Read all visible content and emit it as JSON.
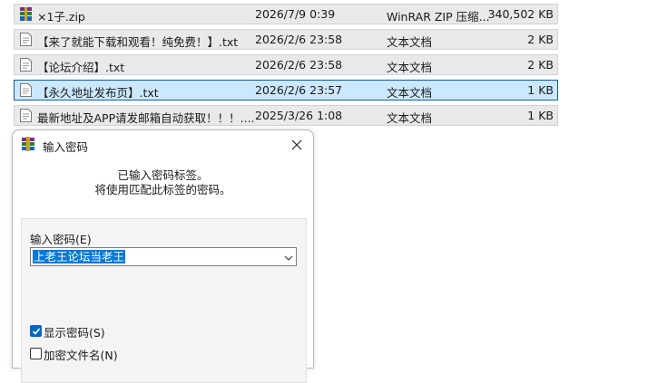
{
  "files": [
    {
      "name": "×1子.zip",
      "date": "2026/7/9 0:39",
      "type": "WinRAR ZIP 压缩...",
      "size": "340,502 KB",
      "icon": "winrar-archive-icon",
      "selected": false
    },
    {
      "name": "【来了就能下载和观看！纯免费！】.txt",
      "date": "2026/2/6 23:58",
      "type": "文本文档",
      "size": "2 KB",
      "icon": "text-file-icon",
      "selected": false
    },
    {
      "name": "【论坛介绍】.txt",
      "date": "2026/2/6 23:58",
      "type": "文本文档",
      "size": "2 KB",
      "icon": "text-file-icon",
      "selected": false
    },
    {
      "name": "【永久地址发布页】.txt",
      "date": "2026/2/6 23:57",
      "type": "文本文档",
      "size": "1 KB",
      "icon": "text-file-icon",
      "selected": true
    },
    {
      "name": "最新地址及APP请发邮箱自动获取！！！....",
      "date": "2025/3/26 1:08",
      "type": "文本文档",
      "size": "1 KB",
      "icon": "text-file-icon",
      "selected": false
    }
  ],
  "dialog": {
    "title": "输入密码",
    "message_line1": "已输入密码标签。",
    "message_line2": "将使用匹配此标签的密码。",
    "password_label": "输入密码(E)",
    "password_value": "上老王论坛当老王",
    "show_password_label": "显示密码(S)",
    "show_password_checked": true,
    "encrypt_names_label": "加密文件名(N)",
    "encrypt_names_checked": false
  },
  "colors": {
    "row_bg": "#e9e9e9",
    "selected_row_bg": "#cce8ff",
    "selected_row_border": "#0f5aa8",
    "selection_highlight": "#0078d7",
    "checkbox_checked": "#0067c0"
  }
}
